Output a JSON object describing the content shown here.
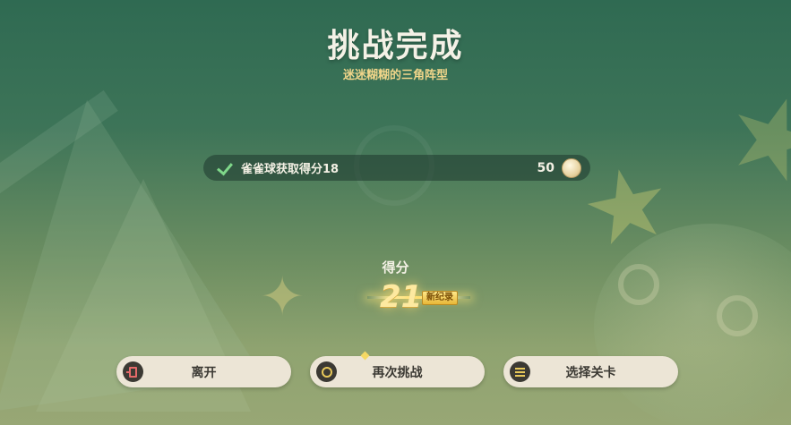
{
  "header": {
    "title": "挑战完成",
    "subtitle": "迷迷糊糊的三角阵型"
  },
  "reward": {
    "label": "雀雀球获取得分18",
    "count": "50",
    "icon": "dumpling-coin-icon"
  },
  "score": {
    "label": "得分",
    "value": "21",
    "badge": "新纪录"
  },
  "buttons": {
    "leave": {
      "label": "离开",
      "icon": "exit-door-icon"
    },
    "retry": {
      "label": "再次挑战",
      "icon": "circle-icon"
    },
    "select": {
      "label": "选择关卡",
      "icon": "menu-icon"
    }
  },
  "colors": {
    "title": "#f4f1e6",
    "subtitle": "#f0d58a",
    "score": "#fde9a0",
    "button_bg": "#ece5d6",
    "check": "#7fd88a"
  }
}
